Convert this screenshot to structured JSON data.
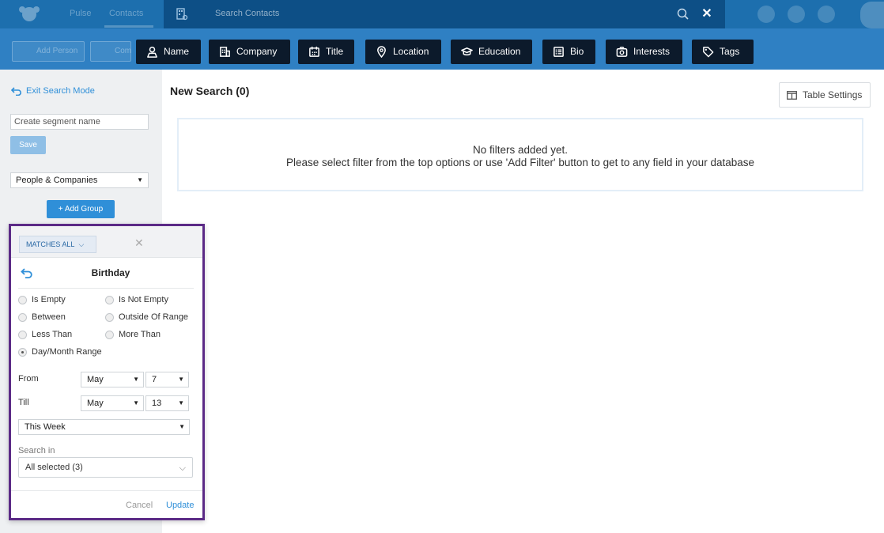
{
  "topbar": {
    "nav": [
      "Pulse",
      "Contacts"
    ],
    "search_placeholder": "Search Contacts"
  },
  "toolbar": {
    "faded_buttons": [
      "Add Person",
      "Com"
    ]
  },
  "filters": [
    {
      "label": "Name",
      "icon": "person-icon"
    },
    {
      "label": "Company",
      "icon": "building-icon"
    },
    {
      "label": "Title",
      "icon": "calendar-icon"
    },
    {
      "label": "Location",
      "icon": "pin-icon"
    },
    {
      "label": "Education",
      "icon": "graduation-cap-icon"
    },
    {
      "label": "Bio",
      "icon": "list-icon"
    },
    {
      "label": "Interests",
      "icon": "camera-icon"
    },
    {
      "label": "Tags",
      "icon": "tag-icon"
    }
  ],
  "sidebar": {
    "exit_label": "Exit Search Mode",
    "segment_placeholder": "Create segment name",
    "save_label": "Save",
    "scope_value": "People & Companies",
    "add_group_label": "+ Add Group"
  },
  "main": {
    "title": "New Search (0)",
    "table_settings_label": "Table Settings",
    "empty_line1": "No filters added yet.",
    "empty_line2": "Please select filter from the top options or use 'Add Filter' button to get to any field in your database"
  },
  "popup": {
    "matches_label": "MATCHES ALL",
    "field_title": "Birthday",
    "options": {
      "is_empty": "Is Empty",
      "is_not_empty": "Is Not Empty",
      "between": "Between",
      "outside_range": "Outside Of Range",
      "less_than": "Less Than",
      "more_than": "More Than",
      "day_month_range": "Day/Month Range"
    },
    "selected_option": "Day/Month Range",
    "from_label": "From",
    "from_month": "May",
    "from_day": "7",
    "till_label": "Till",
    "till_month": "May",
    "till_day": "13",
    "preset": "This Week",
    "search_in_label": "Search in",
    "search_in_value": "All selected (3)",
    "cancel_label": "Cancel",
    "update_label": "Update"
  },
  "colors": {
    "topbar": "#1d6fae",
    "toolbar": "#2f80c3",
    "filter_button": "#0c1a2b",
    "accent": "#2f8fd8",
    "popup_border": "#5b2a86"
  }
}
